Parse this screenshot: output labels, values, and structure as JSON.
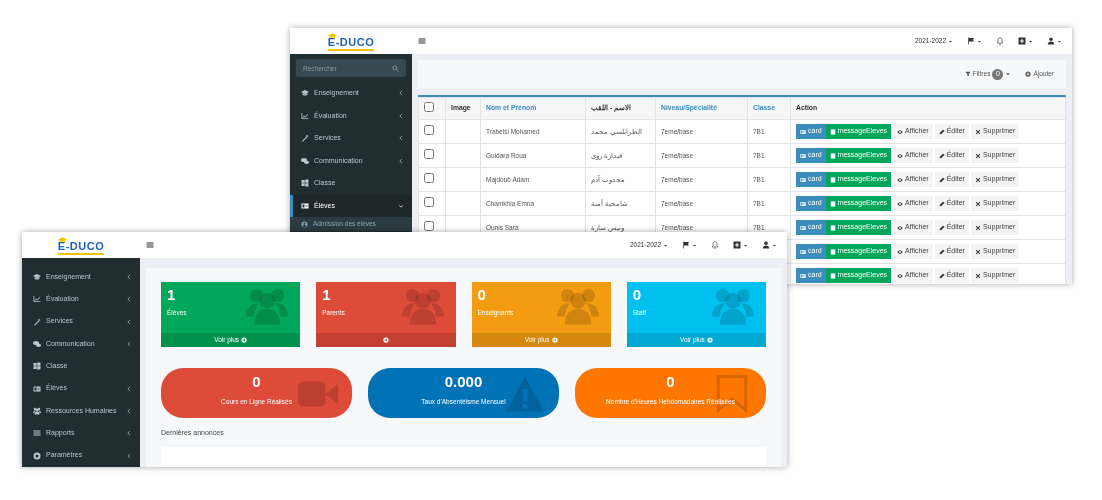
{
  "back_window": {
    "navbar": {
      "logo": "E-DUCO",
      "year": "2021-2022"
    },
    "sidebar": {
      "search": {
        "placeholder": "Rechercher"
      },
      "items": [
        {
          "label": "Enseignement",
          "has_children": true,
          "expanded": false,
          "selected": false
        },
        {
          "label": "Évaluation",
          "has_children": true,
          "expanded": false,
          "selected": false
        },
        {
          "label": "Services",
          "has_children": true,
          "expanded": false,
          "selected": false
        },
        {
          "label": "Communication",
          "has_children": true,
          "expanded": false,
          "selected": false
        },
        {
          "label": "Classe",
          "has_children": false,
          "selected": false
        },
        {
          "label": "Élèves",
          "has_children": true,
          "expanded": true,
          "selected": true,
          "children": [
            {
              "label": "Admission des élèves"
            }
          ]
        }
      ]
    },
    "toolbar": {
      "filters": "Filtres",
      "filter_count": "0",
      "add": "Ajouter"
    },
    "table": {
      "header_checked": false,
      "columns": [
        {
          "label": "Image",
          "sortable": false
        },
        {
          "label": "Nom et Prénom",
          "sortable": true
        },
        {
          "label": "الاسم - اللقب",
          "sortable": false
        },
        {
          "label": "Niveau/Spécialité",
          "sortable": true
        },
        {
          "label": "Classe",
          "sortable": true
        },
        {
          "label": "Action",
          "sortable": false
        }
      ],
      "rows": [
        {
          "checked": false,
          "name": "Trabelsi Mohamed",
          "name_ar": "الطرابلسي محمد",
          "niveau": "7eme/base",
          "classe": "7B1",
          "actions": [
            {
              "kind": "card",
              "label": "card"
            },
            {
              "kind": "message",
              "label": "messageEleves"
            },
            {
              "kind": "show",
              "label": "Afficher"
            },
            {
              "kind": "edit",
              "label": "Éditer"
            },
            {
              "kind": "delete",
              "label": "Supprimer"
            }
          ]
        },
        {
          "checked": false,
          "name": "Guidara Roua",
          "name_ar": "قيدارة روى",
          "niveau": "7eme/base",
          "classe": "7B1",
          "actions": [
            {
              "kind": "card",
              "label": "card"
            },
            {
              "kind": "message",
              "label": "messageEleves"
            },
            {
              "kind": "show",
              "label": "Afficher"
            },
            {
              "kind": "edit",
              "label": "Éditer"
            },
            {
              "kind": "delete",
              "label": "Supprimer"
            }
          ]
        },
        {
          "checked": false,
          "name": "Majdoub Adam",
          "name_ar": "مجدوب آدم",
          "niveau": "7eme/base",
          "classe": "7B1",
          "actions": [
            {
              "kind": "card",
              "label": "card"
            },
            {
              "kind": "message",
              "label": "messageEleves"
            },
            {
              "kind": "show",
              "label": "Afficher"
            },
            {
              "kind": "edit",
              "label": "Éditer"
            },
            {
              "kind": "delete",
              "label": "Supprimer"
            }
          ]
        },
        {
          "checked": false,
          "name": "Chamkhia Emna",
          "name_ar": "شامخية أمنة",
          "niveau": "7eme/base",
          "classe": "7B1",
          "actions": [
            {
              "kind": "card",
              "label": "card"
            },
            {
              "kind": "message",
              "label": "messageEleves"
            },
            {
              "kind": "show",
              "label": "Afficher"
            },
            {
              "kind": "edit",
              "label": "Éditer"
            },
            {
              "kind": "delete",
              "label": "Supprimer"
            }
          ]
        },
        {
          "checked": false,
          "name": "Ounis Sara",
          "name_ar": "ونيس سارة",
          "niveau": "7eme/base",
          "classe": "7B1",
          "actions": [
            {
              "kind": "card",
              "label": "card"
            },
            {
              "kind": "message",
              "label": "messageEleves"
            },
            {
              "kind": "show",
              "label": "Afficher"
            },
            {
              "kind": "edit",
              "label": "Éditer"
            },
            {
              "kind": "delete",
              "label": "Supprimer"
            }
          ]
        },
        {
          "actions": [
            {
              "kind": "card",
              "label": "card"
            },
            {
              "kind": "message",
              "label": "messageEleves"
            },
            {
              "kind": "show",
              "label": "Afficher"
            },
            {
              "kind": "edit",
              "label": "Éditer"
            },
            {
              "kind": "delete",
              "label": "Supprimer"
            }
          ]
        },
        {
          "actions": [
            {
              "kind": "card",
              "label": "card"
            },
            {
              "kind": "message",
              "label": "messageEleves"
            },
            {
              "kind": "show",
              "label": "Afficher"
            },
            {
              "kind": "edit",
              "label": "Éditer"
            },
            {
              "kind": "delete",
              "label": "Supprimer"
            }
          ]
        }
      ]
    }
  },
  "front_window": {
    "navbar": {
      "logo": "E-DUCO",
      "year": "2021-2022"
    },
    "sidebar": {
      "items": [
        {
          "label": "Enseignement",
          "has_children": true,
          "expanded": false,
          "selected": false
        },
        {
          "label": "Évaluation",
          "has_children": true,
          "expanded": false,
          "selected": false
        },
        {
          "label": "Services",
          "has_children": true,
          "expanded": false,
          "selected": false
        },
        {
          "label": "Communication",
          "has_children": true,
          "expanded": false,
          "selected": false
        },
        {
          "label": "Classe",
          "has_children": false,
          "selected": false
        },
        {
          "label": "Élèves",
          "has_children": true,
          "expanded": false,
          "selected": false
        },
        {
          "label": "Ressources Humaines",
          "has_children": true,
          "expanded": false,
          "selected": false
        },
        {
          "label": "Rapports",
          "has_children": true,
          "expanded": false,
          "selected": false
        },
        {
          "label": "Paramètres",
          "has_children": true,
          "expanded": false,
          "selected": false
        }
      ]
    },
    "stat_cards": [
      {
        "value": "1",
        "label": "Élèves",
        "link": "Voir plus",
        "color": "#00a65a"
      },
      {
        "value": "1",
        "label": "Parents",
        "color": "#dd4b39"
      },
      {
        "value": "0",
        "label": "Enseignants",
        "link": "Voir plus",
        "color": "#f39c12"
      },
      {
        "value": "0",
        "label": "Staff",
        "link": "Voir plus",
        "color": "#00c0ef"
      }
    ],
    "stat_pills": [
      {
        "value": "0",
        "label": "Cours en Ligne Réalisés",
        "kind": "video",
        "color": "#dd4b39"
      },
      {
        "value": "0.000",
        "label": "Taux d'Absentéisme Mensuel",
        "kind": "warning",
        "color": "#0073b7"
      },
      {
        "value": "0",
        "label": "Nombre d'Heures Hebdomadaires Réalisées",
        "kind": "bookmark",
        "color": "#ff7701"
      }
    ],
    "announcements": {
      "title": "Dernières annonces"
    }
  }
}
